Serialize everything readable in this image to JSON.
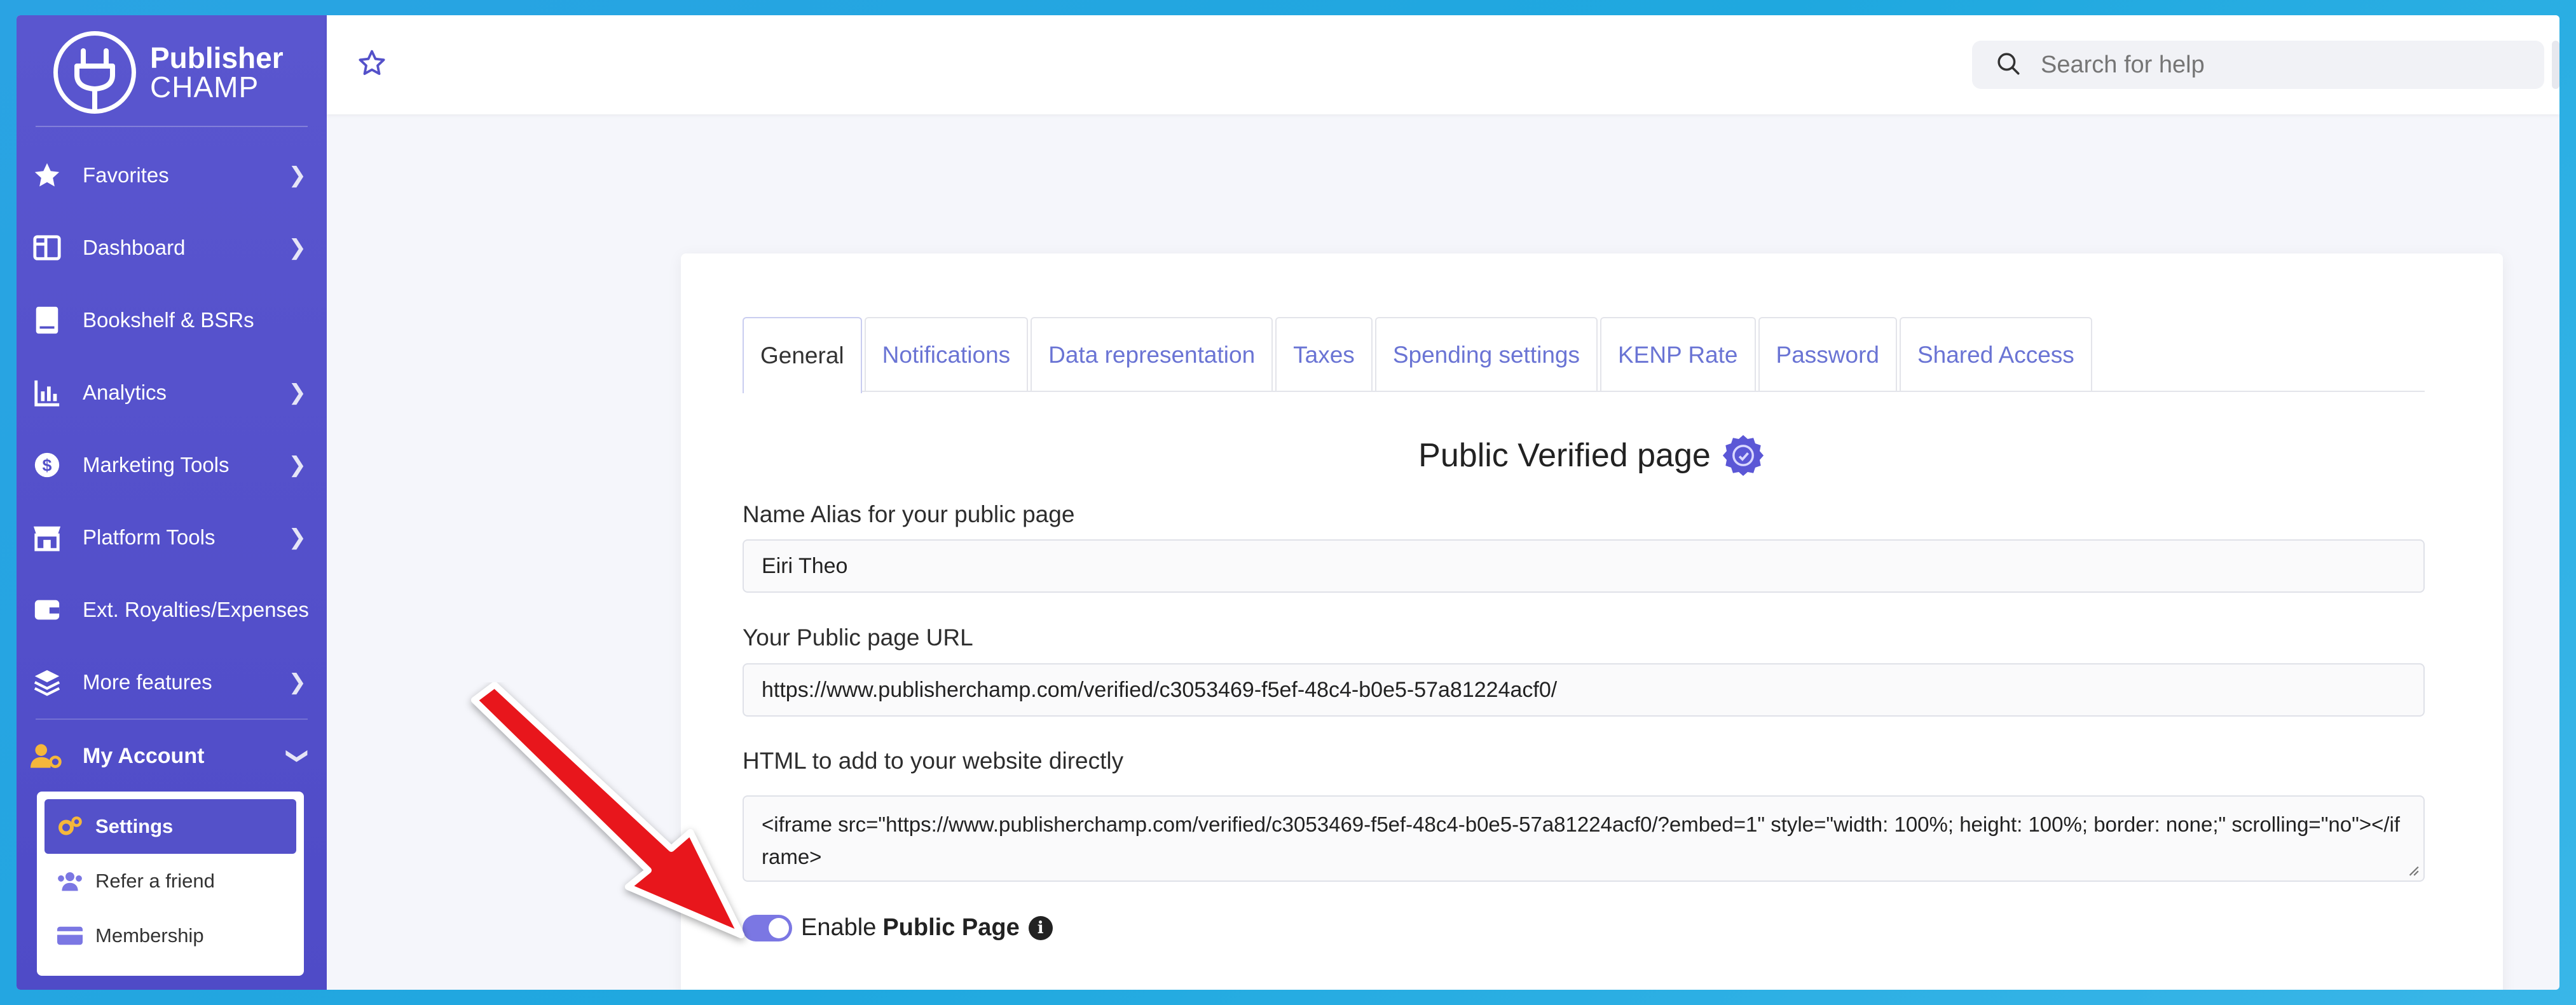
{
  "brand": {
    "line1": "Publisher",
    "line2": "CHAMP"
  },
  "sidebar": {
    "items": [
      {
        "label": "Favorites",
        "icon": "star-icon",
        "chevron": true
      },
      {
        "label": "Dashboard",
        "icon": "layout-icon",
        "chevron": true
      },
      {
        "label": "Bookshelf & BSRs",
        "icon": "book-icon",
        "chevron": false
      },
      {
        "label": "Analytics",
        "icon": "bar-chart-icon",
        "chevron": true
      },
      {
        "label": "Marketing Tools",
        "icon": "dollar-icon",
        "chevron": true
      },
      {
        "label": "Platform Tools",
        "icon": "store-icon",
        "chevron": true
      },
      {
        "label": "Ext. Royalties/Expenses",
        "icon": "wallet-icon",
        "chevron": false
      },
      {
        "label": "More features",
        "icon": "layers-icon",
        "chevron": true
      }
    ],
    "account": {
      "label": "My Account"
    },
    "submenu": [
      {
        "label": "Settings",
        "icon": "gears-icon"
      },
      {
        "label": "Refer a friend",
        "icon": "users-icon"
      },
      {
        "label": "Membership",
        "icon": "card-icon"
      }
    ]
  },
  "topbar": {
    "search_placeholder": "Search for help"
  },
  "tabs": [
    "General",
    "Notifications",
    "Data representation",
    "Taxes",
    "Spending settings",
    "KENP Rate",
    "Password",
    "Shared Access"
  ],
  "main": {
    "heading": "Public Verified page",
    "alias_label": "Name Alias for your public page",
    "alias_value": "Eiri Theo",
    "url_label": "Your Public page URL",
    "url_value": "https://www.publisherchamp.com/verified/c3053469-f5ef-48c4-b0e5-57a81224acf0/",
    "html_label": "HTML to add to your website directly",
    "html_value": "<iframe src=\"https://www.publisherchamp.com/verified/c3053469-f5ef-48c4-b0e5-57a81224acf0/?embed=1\" style=\"width: 100%; height: 100%; border: none;\" scrolling=\"no\"></iframe>",
    "toggle_prefix": "Enable",
    "toggle_bold": "Public Page",
    "toggle_on": true
  },
  "colors": {
    "sidebar": "#5451c9",
    "accent": "#6a74d4",
    "arrow": "#e8161b"
  }
}
